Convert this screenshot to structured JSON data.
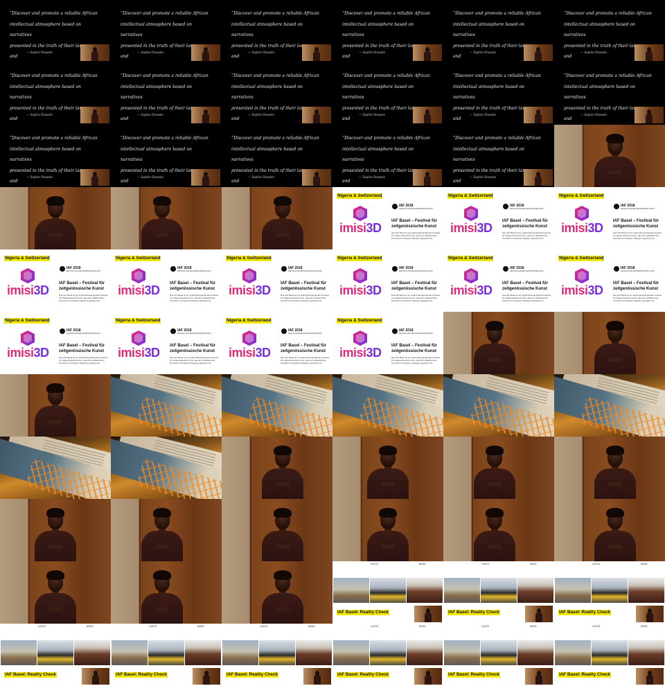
{
  "quote": {
    "text": "“Discover and promote a reliable African\nintellectual atmosphere based on narratives\npresented in the truth of their language and\nauthenticity”",
    "author": "— Sophie Oluwole"
  },
  "imisi_slide": {
    "tag": "Nigeria & Switzerland",
    "logo_part1": "imisi",
    "logo_part2": "3D",
    "iaf_year": "IAF 2018",
    "iaf_subtitle": "FESTIVAL FOR ZEITGENÖSSISCHE KUNST",
    "title": "IAF Basel – Festival für zeitgenössische Kunst",
    "body": "Das IAF Basel ist ein spartenübergreifendes Festival für zeitgenössische Kunst, das dem afrikanischen Kontinent und dessen Diaspora gewidmet ist."
  },
  "reality_slide": {
    "city_left": "LAGOS",
    "city_right": "BASEL",
    "title": "IAF Basel: Reality Check"
  },
  "tiles": [
    "quote",
    "quote",
    "quote",
    "quote",
    "quote",
    "quote",
    "quote",
    "quote",
    "quote",
    "quote",
    "quote",
    "quote",
    "quote",
    "quote",
    "quote",
    "quote",
    "quote",
    "speaker",
    "speaker",
    "speaker",
    "speaker",
    "imisi",
    "imisi",
    "imisi",
    "imisi",
    "imisi",
    "imisi",
    "imisi",
    "imisi",
    "imisi",
    "imisi",
    "imisi",
    "imisi",
    "imisi",
    "speaker",
    "speaker",
    "speaker",
    "flyer",
    "flyer",
    "flyer",
    "flyer",
    "flyer",
    "flyer",
    "flyer",
    "speaker",
    "speaker",
    "speaker",
    "speaker",
    "speaker",
    "speaker",
    "speaker",
    "speaker",
    "speaker",
    "speaker",
    "speaker",
    "speaker",
    "speaker",
    "reality",
    "reality",
    "reality",
    "reality",
    "reality",
    "reality",
    "reality",
    "reality",
    "reality"
  ]
}
